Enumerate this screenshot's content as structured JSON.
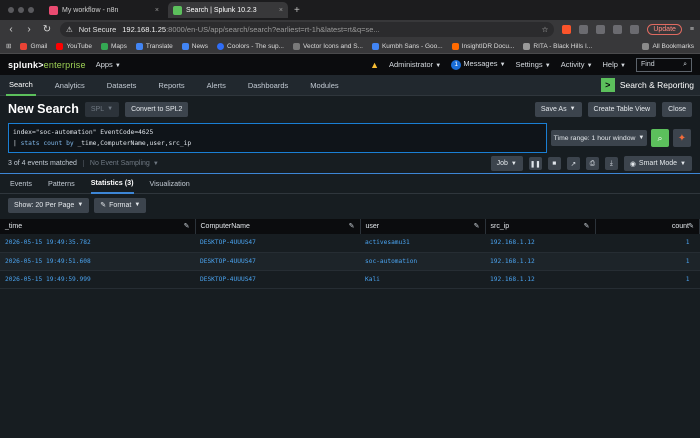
{
  "browser": {
    "tabs": [
      {
        "label": "My workflow - n8n",
        "active": false
      },
      {
        "label": "Search | Splunk 10.2.3",
        "active": true
      }
    ],
    "url": {
      "security": "Not Secure",
      "host": "192.168.1.25",
      "path": ":8000/en-US/app/search/search?earliest=rt-1h&latest=rt&q=se..."
    },
    "update_label": "Update",
    "bookmarks": [
      {
        "label": "Gmail",
        "color": "#ea4335"
      },
      {
        "label": "YouTube",
        "color": "#ff0000"
      },
      {
        "label": "Maps",
        "color": "#34a853"
      },
      {
        "label": "Translate",
        "color": "#4285f4"
      },
      {
        "label": "News",
        "color": "#4285f4"
      },
      {
        "label": "Coolors - The sup...",
        "color": "#2f6df6"
      },
      {
        "label": "Vector Icons and S...",
        "color": "#7a7a7a"
      },
      {
        "label": "Kumbh Sans - Goo...",
        "color": "#4285f4"
      },
      {
        "label": "InsightIDR Docu...",
        "color": "#ff6a00"
      },
      {
        "label": "RITA - Black Hills I...",
        "color": "#999999"
      }
    ],
    "all_bookmarks_label": "All Bookmarks"
  },
  "splunk": {
    "logo_main": "splunk>",
    "logo_sub": "enterprise",
    "apps_label": "Apps",
    "top_menu": {
      "administrator": "Administrator",
      "messages_count": "1",
      "messages": "Messages",
      "settings": "Settings",
      "activity": "Activity",
      "help": "Help",
      "find": "Find"
    },
    "app_nav": [
      "Search",
      "Analytics",
      "Datasets",
      "Reports",
      "Alerts",
      "Dashboards",
      "Modules"
    ],
    "app_brand": "Search & Reporting",
    "page_title": "New Search",
    "spl_label": "SPL",
    "convert_label": "Convert to SPL2",
    "save_as": "Save As",
    "create_table_view": "Create Table View",
    "close": "Close",
    "query": {
      "line1_prefix": "index=\"soc-automation\" EventCode=4625",
      "line2_pipe": "| ",
      "line2_cmd": "stats count by",
      "line2_rest": " _time,ComputerName,user,src_ip"
    },
    "time_range": "Time range: 1 hour window",
    "events_matched": "3 of 4 events matched",
    "event_sampling": "No Event Sampling",
    "job_label": "Job",
    "smart_mode": "Smart Mode",
    "result_tabs": [
      "Events",
      "Patterns",
      "Statistics (3)",
      "Visualization"
    ],
    "per_page": "Show: 20 Per Page",
    "format": "Format",
    "table": {
      "headers": [
        "_time",
        "ComputerName",
        "user",
        "src_ip",
        "count"
      ],
      "rows": [
        [
          "2026-05-15 19:49:35.782",
          "DESKTOP-4UUUS47",
          "activesamu31",
          "192.168.1.12",
          "1"
        ],
        [
          "2026-05-15 19:49:51.608",
          "DESKTOP-4UUUS47",
          "soc-automation",
          "192.168.1.12",
          "1"
        ],
        [
          "2026-05-15 19:49:59.999",
          "DESKTOP-4UUUS47",
          "Kali",
          "192.168.1.12",
          "1"
        ]
      ]
    }
  }
}
